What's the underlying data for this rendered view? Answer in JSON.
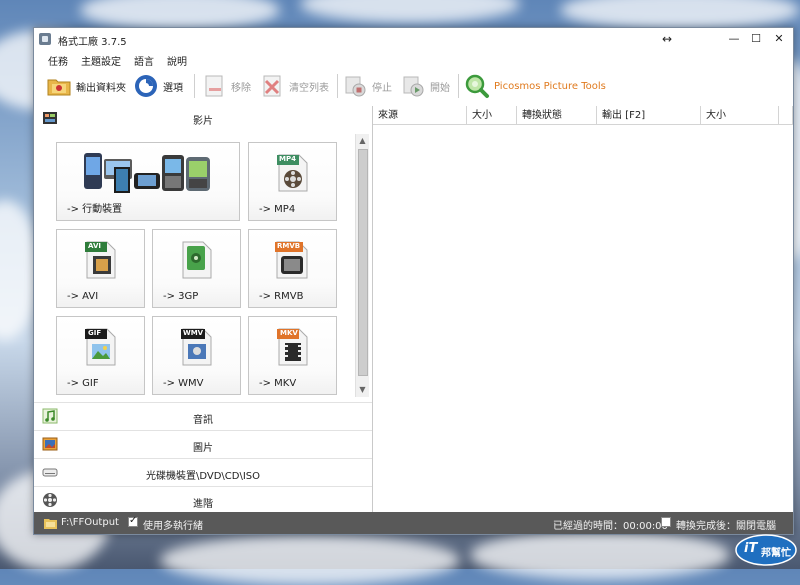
{
  "window": {
    "title": "格式工廠 3.7.5",
    "resize_glyph": "↔",
    "controls": {
      "minimize": "—",
      "maximize": "☐",
      "close": "✕"
    }
  },
  "menu": [
    "任務",
    "主題設定",
    "語言",
    "說明"
  ],
  "toolbar": {
    "output_folder": "輸出資料夾",
    "options": "選項",
    "remove": "移除",
    "clear_list": "清空列表",
    "stop": "停止",
    "start": "開始",
    "picosmos": "Picosmos Picture Tools"
  },
  "left_panel": {
    "video_category": "影片",
    "tiles": [
      {
        "label": "-> 行動裝置",
        "icon": "mobile-devices-icon"
      },
      {
        "label": "-> MP4",
        "icon": "mp4-file-icon",
        "badge": "MP4"
      },
      {
        "label": "-> AVI",
        "icon": "avi-file-icon",
        "badge": "AVI"
      },
      {
        "label": "-> 3GP",
        "icon": "3gp-file-icon",
        "badge": "3GP"
      },
      {
        "label": "-> RMVB",
        "icon": "rmvb-file-icon",
        "badge": "RMVB"
      },
      {
        "label": "-> GIF",
        "icon": "gif-file-icon",
        "badge": "GIF"
      },
      {
        "label": "-> WMV",
        "icon": "wmv-file-icon",
        "badge": "WMV"
      },
      {
        "label": "-> MKV",
        "icon": "mkv-file-icon",
        "badge": "MKV"
      }
    ],
    "categories": [
      {
        "label": "音訊",
        "icon": "audio-note-icon"
      },
      {
        "label": "圖片",
        "icon": "picture-icon"
      },
      {
        "label": "光碟機裝置\\DVD\\CD\\ISO",
        "icon": "optical-drive-icon"
      },
      {
        "label": "進階",
        "icon": "advanced-reel-icon"
      }
    ]
  },
  "task_list": {
    "columns": [
      "來源",
      "大小",
      "轉換狀態",
      "輸出 [F2]",
      "大小"
    ]
  },
  "status_bar": {
    "output_path": "F:\\FFOutput",
    "multithread_label": "使用多執行緒",
    "multithread_checked": true,
    "elapsed": "已經過的時間：00:00:00",
    "after_convert_checked": false,
    "after_convert_label": "轉換完成後：關閉電腦"
  },
  "watermark": {
    "text_1": "iT",
    "text_2": "邦幫忙"
  },
  "colors": {
    "statusbar_bg": "#595959",
    "picosmos_text": "#e07a1e",
    "mp4_badge": "#3e8e62",
    "avi_badge": "#2f7d3b",
    "3gp_badge": "#48a24a",
    "rmvb_badge": "#e0742a",
    "gif_badge": "#1c1c1c",
    "wmv_badge": "#1c1c1c",
    "mkv_badge": "#e0742a"
  }
}
